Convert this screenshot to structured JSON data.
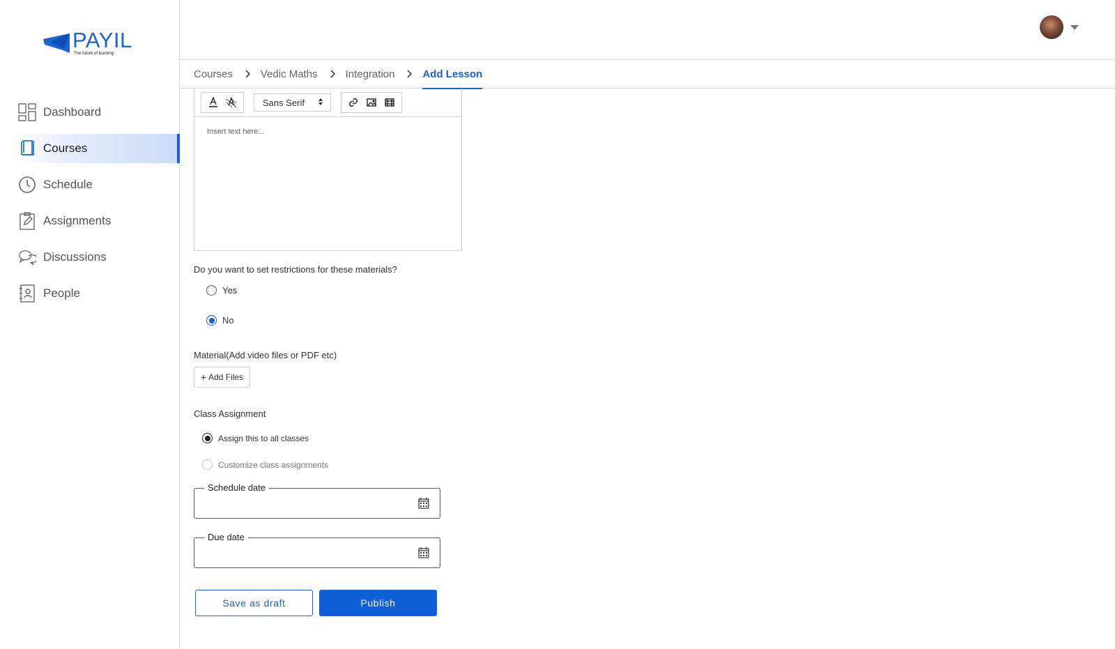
{
  "brand": {
    "name": "PAYIL",
    "tagline": "The future of learning",
    "color": "#1a63d8"
  },
  "sidebar": {
    "items": [
      {
        "label": "Dashboard",
        "icon": "dashboard-icon"
      },
      {
        "label": "Courses",
        "icon": "book-icon",
        "active": true
      },
      {
        "label": "Schedule",
        "icon": "clock-icon"
      },
      {
        "label": "Assignments",
        "icon": "clipboard-icon"
      },
      {
        "label": "Discussions",
        "icon": "chat-icon"
      },
      {
        "label": "People",
        "icon": "contact-book-icon"
      }
    ]
  },
  "breadcrumb": {
    "items": [
      "Courses",
      "Vedic Maths",
      "Integration"
    ],
    "current": "Add Lesson"
  },
  "editor": {
    "font": "Sans Serif",
    "placeholder": "Insert text here..."
  },
  "restrictions": {
    "question": "Do you want to set restrictions for these materials?",
    "options": [
      "Yes",
      "No"
    ],
    "selected": "No"
  },
  "material": {
    "label": "Material(Add video files or PDF etc)",
    "add_button": "Add Files"
  },
  "class_assignment": {
    "label": "Class Assignment",
    "options": [
      "Assign this to all classes",
      "Customize class assignments"
    ],
    "selected": "Assign this to all classes"
  },
  "schedule_date": {
    "label": "Schedule date",
    "value": ""
  },
  "due_date": {
    "label": "Due date",
    "value": ""
  },
  "actions": {
    "draft": "Save as draft",
    "publish": "Publish"
  },
  "colors": {
    "accent": "#1a5fd3",
    "border": "#d6d6d6"
  }
}
